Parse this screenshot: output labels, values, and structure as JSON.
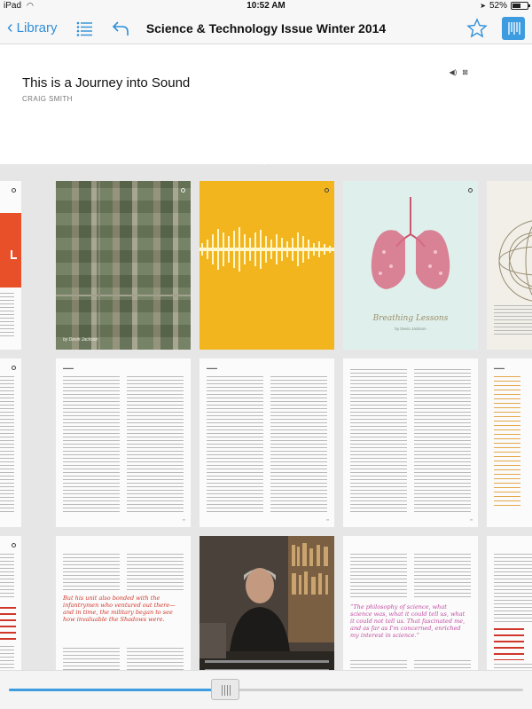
{
  "status": {
    "carrier": "iPad",
    "time": "10:52 AM",
    "battery": "52%",
    "battery_level": 0.52
  },
  "nav": {
    "back_label": "Library",
    "title": "Science & Technology Issue Winter 2014"
  },
  "article": {
    "title": "This is a Journey into Sound",
    "author": "CRAIG SMITH"
  },
  "pages": {
    "col_b_r1_byline": "by Devin Jackson",
    "col_d_r1_title": "Breathing Lessons",
    "col_d_r1_byline": "by Devin Jackson",
    "col_b_r3_quote": "But his unit also bonded with the infantrymen who ventured out there—and in time, the military began to see how invaluable the Shadows were.",
    "col_d_r3_quote": "“The philosophy of science, what science was, what it could tell us, what it could not tell us. That fascinated me, and as far as I'm concerned, enriched my interest in science.”"
  },
  "scrubber": {
    "progress": 0.42
  },
  "colors": {
    "accent": "#3d9be0",
    "orange_cover": "#e8502a",
    "yellow_cover": "#f2b51e",
    "mint_cover": "#dff0ec",
    "red_quote": "#d0362a",
    "pink_quote": "#c04aa0"
  }
}
